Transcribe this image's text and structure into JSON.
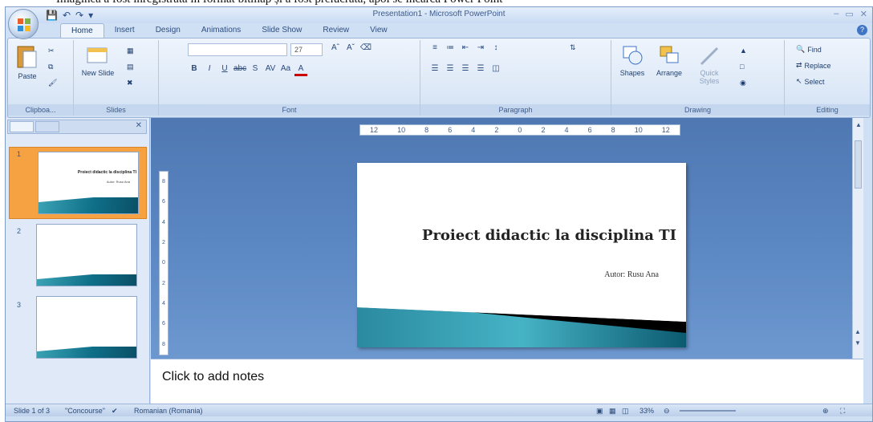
{
  "doc_caption": "Imaginea a fost înregistrată în format bitmap și a fost prelucrată, apoi se încarcă Power Point",
  "window": {
    "title": "Presentation1 - Microsoft PowerPoint",
    "help": "?",
    "controls": {
      "minimize": "–",
      "maximize": "▭",
      "close": "✕"
    }
  },
  "qat": {
    "save_icon": "save-icon",
    "undo_icon": "undo-icon",
    "redo_icon": "redo-icon",
    "dropdown": "▾"
  },
  "tabs": [
    "Home",
    "Insert",
    "Design",
    "Animations",
    "Slide Show",
    "Review",
    "View"
  ],
  "ribbon": {
    "clipboard": {
      "paste": "Paste",
      "label": "Clipboa..."
    },
    "slides": {
      "new_slide": "New Slide",
      "label": "Slides"
    },
    "font": {
      "size": "27",
      "label": "Font"
    },
    "paragraph": {
      "label": "Paragraph"
    },
    "drawing": {
      "shapes": "Shapes",
      "arrange": "Arrange",
      "quick_styles": "Quick Styles",
      "label": "Drawing"
    },
    "editing": {
      "find": "Find",
      "replace": "Replace",
      "select": "Select",
      "label": "Editing"
    }
  },
  "thumbnails": [
    {
      "num": "1",
      "title": "Proiect didactic la disciplina TI",
      "subtitle": "Autor: Rusu Ana"
    },
    {
      "num": "2"
    },
    {
      "num": "3"
    }
  ],
  "ruler": {
    "h": [
      "12",
      "10",
      "8",
      "6",
      "4",
      "2",
      "0",
      "2",
      "4",
      "6",
      "8",
      "10",
      "12"
    ],
    "v": [
      "8",
      "6",
      "4",
      "2",
      "0",
      "2",
      "4",
      "6",
      "8"
    ]
  },
  "slide": {
    "title": "Proiect didactic la disciplina TI",
    "subtitle": "Autor: Rusu Ana"
  },
  "notes_placeholder": "Click to add notes",
  "status": {
    "slide": "Slide 1 of 3",
    "theme": "\"Concourse\"",
    "language": "Romanian (Romania)",
    "zoom": "33%"
  },
  "colors": {
    "accent": "#f6a142",
    "workarea": "#5a86c2",
    "ribbon": "#dce8f7",
    "swoosh": "#0f6f88"
  }
}
